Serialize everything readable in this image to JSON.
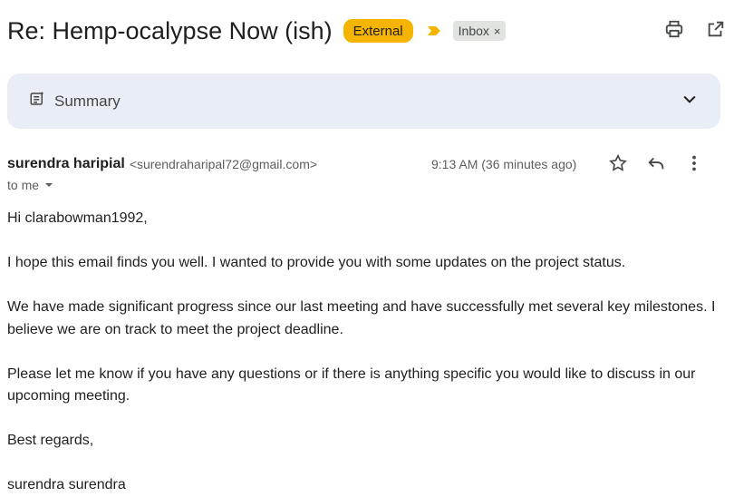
{
  "email": {
    "subject": "Re: Hemp-ocalypse Now (ish)",
    "external_label": "External",
    "inbox_label": "Inbox",
    "inbox_close": "×"
  },
  "summary": {
    "label": "Summary"
  },
  "message": {
    "sender_name": "surendra haripial",
    "sender_email": "<surendraharipal72@gmail.com>",
    "time": "9:13 AM (36 minutes ago)",
    "to_label": "to me",
    "greeting": "Hi clarabowman1992,",
    "paragraph1": "I hope this email finds you well. I wanted to provide you with some updates on the project status.",
    "paragraph2": "We have made significant progress since our last meeting and have successfully met several key milestones. I believe we are on track to meet the project deadline.",
    "paragraph3": "Please let me know if you have any questions or if there is anything specific you would like to discuss in our upcoming meeting.",
    "closing": "Best regards,",
    "signature": "surendra surendra"
  },
  "colors": {
    "external_badge": "#f5b400",
    "importance_marker": "#f5b400",
    "summary_bg": "#e9eef6",
    "inbox_badge": "#e1e3e1"
  },
  "icons": [
    "print-icon",
    "open-in-new-icon",
    "summary-icon",
    "chevron-down-icon",
    "star-icon",
    "reply-icon",
    "more-vert-icon",
    "caret-down-icon",
    "importance-marker-icon"
  ]
}
